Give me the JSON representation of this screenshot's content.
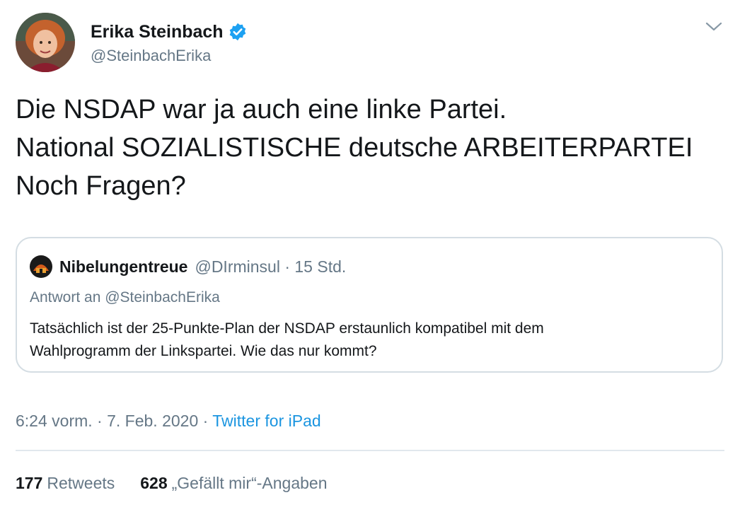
{
  "author": {
    "display_name": "Erika Steinbach",
    "handle": "@SteinbachErika",
    "verified": true
  },
  "tweet": {
    "lines": [
      "Die NSDAP war ja auch eine linke Partei.",
      "National SOZIALISTISCHE deutsche ARBEITERPARTEI",
      "Noch Fragen?"
    ]
  },
  "quoted_tweet": {
    "display_name": "Nibelungentreue",
    "handle_time": "@DIrminsul · 15 Std.",
    "reply_to": "Antwort an @SteinbachErika",
    "lines": [
      "Tatsächlich ist der 25-Punkte-Plan der NSDAP erstaunlich kompatibel mit dem",
      "Wahlprogramm der Linkspartei. Wie das nur kommt?"
    ]
  },
  "meta": {
    "time_date": "6:24 vorm. · 7. Feb. 2020 · ",
    "source": "Twitter for iPad"
  },
  "stats": {
    "retweets_count": "177",
    "retweets_label": "Retweets",
    "likes_count": "628",
    "likes_label": "„Gefällt mir“-Angaben"
  },
  "colors": {
    "text": "#14171a",
    "secondary": "#657786",
    "link": "#1b95e0",
    "verified": "#1da1f2",
    "border": "#d4dde3"
  },
  "icons": {
    "verified": "verified-badge-icon",
    "caret": "chevron-down-icon"
  }
}
